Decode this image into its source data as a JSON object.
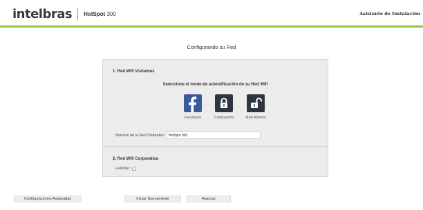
{
  "header": {
    "logo": "intelbras",
    "product_name": "HotSpot",
    "product_number": "300",
    "wizard_title": "Asistente de Instalación",
    "accent_color": "#8dc63f"
  },
  "main": {
    "heading": "Configurando su Red"
  },
  "visitors_section": {
    "title": "1. Red Wifi Visitantes",
    "instruction": "Seleccione el modo de autentificación de su Red Wifi",
    "options": [
      {
        "label": "Facebook",
        "icon": "facebook-icon",
        "color": "#3b5998"
      },
      {
        "label": "Contraseña",
        "icon": "lock-icon",
        "color": "#2e3540"
      },
      {
        "label": "Red Abierta",
        "icon": "unlock-icon",
        "color": "#2e3540"
      }
    ],
    "network_name_label": "Nombre de la Red Visitantes:",
    "network_name_value": "HotSpot 300"
  },
  "corporate_section": {
    "title": "2. Red Wifi Corporativa",
    "enable_label": "Habilitar:"
  },
  "buttons": {
    "advanced": "Configuraciones Avanzadas",
    "restart": "Iniciar Nuevamente",
    "next": "Avanzar"
  }
}
